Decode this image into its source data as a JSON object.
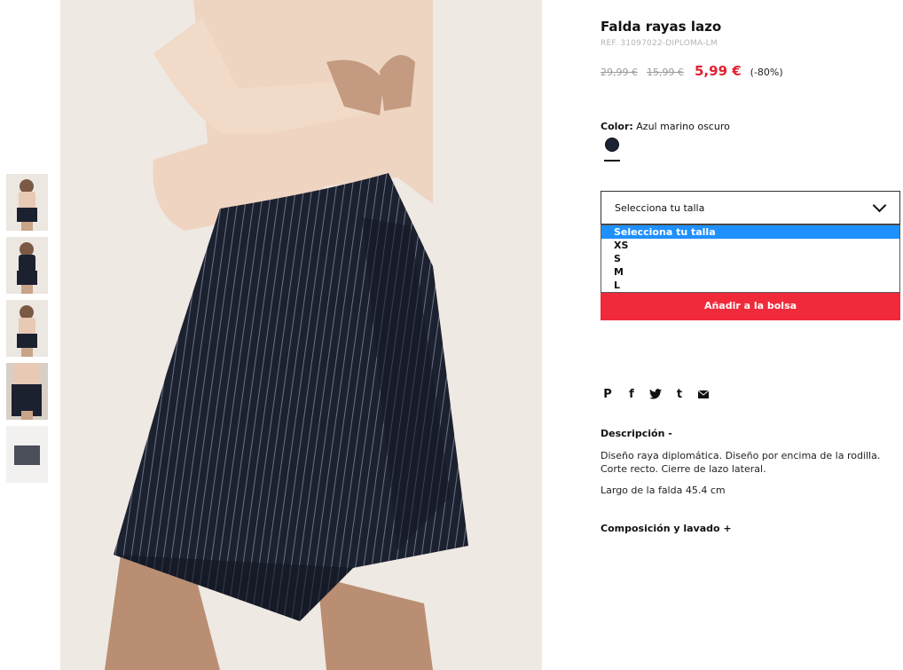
{
  "product": {
    "title": "Falda rayas lazo",
    "ref": "REF. 31097022-DIPLOMA-LM",
    "prices": {
      "original": "29,99 €",
      "previous": "15,99 €",
      "current": "5,99 €",
      "discount": "(-80%)"
    },
    "color": {
      "label": "Color:",
      "value": "Azul marino oscuro",
      "swatch_hex": "#1b2233"
    },
    "size_select": {
      "value": "Selecciona tu talla",
      "options": [
        "Selecciona tu talla",
        "XS",
        "S",
        "M",
        "L"
      ]
    },
    "add_to_bag": "Añadir a la bolsa",
    "share_icons": [
      "pinterest-icon",
      "facebook-icon",
      "twitter-icon",
      "tumblr-icon",
      "email-icon"
    ],
    "share_glyphs": {
      "pinterest": "P",
      "facebook": "f",
      "tumblr": "t"
    },
    "description": {
      "heading": "Descripción -",
      "text": "Diseño raya diplomática. Diseño por encima de la rodilla. Corte recto. Cierre de lazo lateral.",
      "length": "Largo de la falda 45.4 cm"
    },
    "composition": {
      "heading": "Composición y lavado +"
    }
  },
  "theme": {
    "sale_red": "#e0212f",
    "button_red": "#f02a3a",
    "dropdown_highlight": "#1e90ff"
  }
}
